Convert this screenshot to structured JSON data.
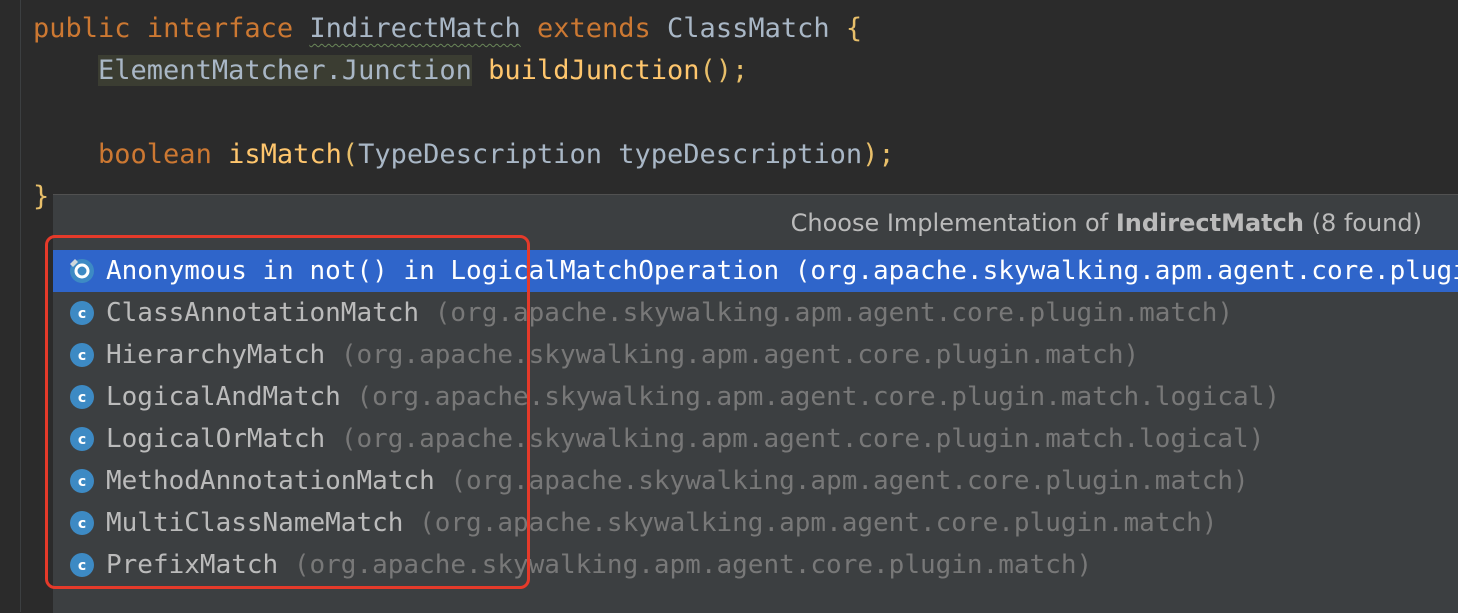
{
  "code": {
    "line1": {
      "kw_public": "public",
      "kw_interface": "interface",
      "iface_name": "IndirectMatch",
      "kw_extends": "extends",
      "super_name": "ClassMatch",
      "open_brace": "{"
    },
    "line2": {
      "return_type": "ElementMatcher.Junction",
      "method": "buildJunction",
      "suffix": "();"
    },
    "line4": {
      "kw_boolean": "boolean",
      "method": "isMatch",
      "param_type": "TypeDescription",
      "param_name": "typeDescription",
      "suffix": ");"
    },
    "close_brace": "}"
  },
  "popup": {
    "title_prefix": "Choose Implementation of",
    "title_bold": "IndirectMatch",
    "title_suffix": "(8 found)",
    "items": [
      {
        "name": "Anonymous in not() in LogicalMatchOperation",
        "pkg": "(org.apache.skywalking.apm.agent.core.plugin.match.logical)",
        "icon": "anonymous-class-icon",
        "selected": true
      },
      {
        "name": "ClassAnnotationMatch",
        "pkg": "(org.apache.skywalking.apm.agent.core.plugin.match)",
        "icon": "class-icon"
      },
      {
        "name": "HierarchyMatch",
        "pkg": "(org.apache.skywalking.apm.agent.core.plugin.match)",
        "icon": "class-icon"
      },
      {
        "name": "LogicalAndMatch",
        "pkg": "(org.apache.skywalking.apm.agent.core.plugin.match.logical)",
        "icon": "class-icon"
      },
      {
        "name": "LogicalOrMatch",
        "pkg": "(org.apache.skywalking.apm.agent.core.plugin.match.logical)",
        "icon": "class-icon"
      },
      {
        "name": "MethodAnnotationMatch",
        "pkg": "(org.apache.skywalking.apm.agent.core.plugin.match)",
        "icon": "class-icon"
      },
      {
        "name": "MultiClassNameMatch",
        "pkg": "(org.apache.skywalking.apm.agent.core.plugin.match)",
        "icon": "class-icon"
      },
      {
        "name": "PrefixMatch",
        "pkg": "(org.apache.skywalking.apm.agent.core.plugin.match)",
        "icon": "class-icon"
      }
    ]
  },
  "colors": {
    "selection": "#2f65ca",
    "class_icon": "#3d8ac4",
    "annotation_box": "#e53a2a"
  }
}
